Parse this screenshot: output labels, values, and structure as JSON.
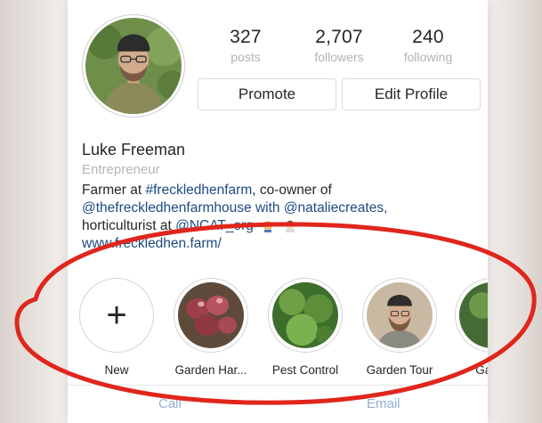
{
  "profile": {
    "stats": [
      {
        "value": "327",
        "label": "posts"
      },
      {
        "value": "2,707",
        "label": "followers"
      },
      {
        "value": "240",
        "label": "following"
      }
    ],
    "buttons": {
      "promote": "Promote",
      "edit": "Edit Profile"
    },
    "name": "Luke Freeman",
    "category": "Entrepreneur",
    "bio": {
      "line1_prefix": "Farmer at ",
      "line1_tag": "#freckledhenfarm",
      "line1_suffix": ", co-owner of",
      "line2": "@thefreckledhenfarmhouse with @nataliecreates,",
      "line3_prefix": "horticulturist at ",
      "line3_mention": "@NCAT_org",
      "website": "www.freckledhen.farm/"
    }
  },
  "highlights": [
    {
      "label": "New",
      "icon": "plus-icon"
    },
    {
      "label": "Garden Har..."
    },
    {
      "label": "Pest Control"
    },
    {
      "label": "Garden Tour"
    },
    {
      "label": "Garde"
    }
  ],
  "bottom_actions": {
    "call": "Call",
    "email": "Email"
  },
  "colors": {
    "link": "#1d4a82",
    "muted": "#b3b3b3",
    "annotation": "#e0261c"
  }
}
